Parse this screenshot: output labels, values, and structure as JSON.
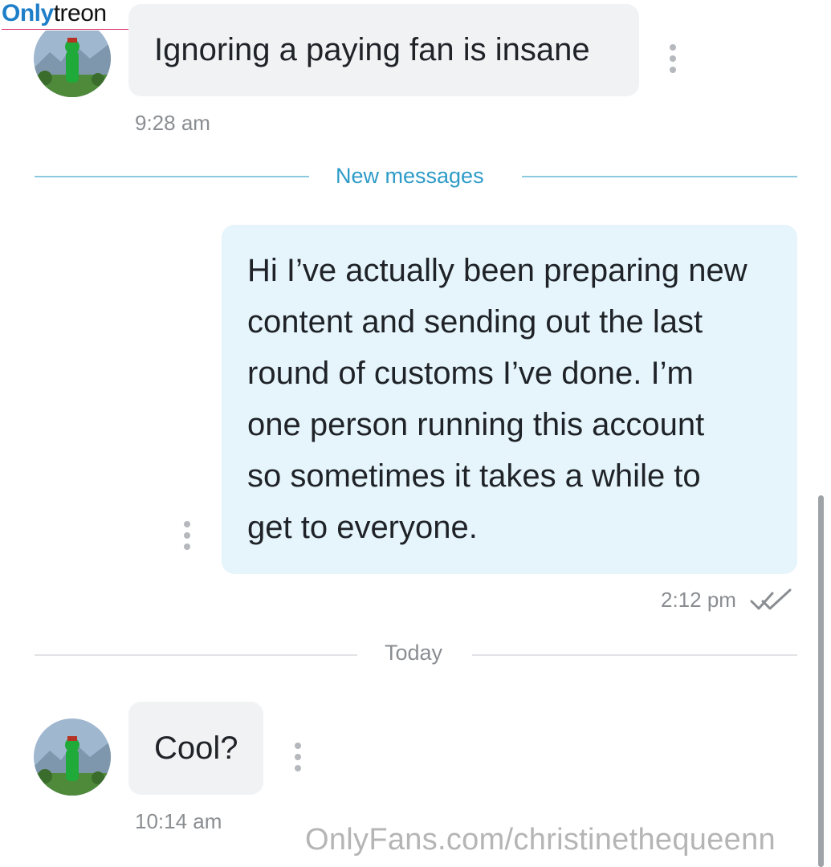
{
  "watermark": {
    "top_bold": "Only",
    "top_thin": "treon",
    "bottom": "OnlyFans.com/christinethequeenn"
  },
  "conversation": {
    "messages": [
      {
        "direction": "incoming",
        "text": "Ignoring a paying fan is insane",
        "time": "9:28 am"
      },
      {
        "direction": "outgoing",
        "lines": [
          "Hi I’ve actually been preparing new",
          "content and sending out the last",
          "round of customs I’ve done. I’m",
          "one person running this account",
          "so sometimes it takes a while to",
          "get to everyone."
        ],
        "time": "2:12 pm",
        "status_icon": "double-check-icon"
      },
      {
        "direction": "incoming",
        "text": "Cool?",
        "time": "10:14 am"
      }
    ],
    "dividers": {
      "new_messages": "New messages",
      "today": "Today"
    }
  },
  "colors": {
    "incoming_bubble": "#f0f2f4",
    "outgoing_bubble": "#e5f5fb",
    "new_messages_accent": "#2d9bc7",
    "timestamp": "#8a8d91",
    "watermark_blue": "#1e7fc8"
  },
  "icons": {
    "avatar": "avatar-icon",
    "menu": "more-vertical-icon",
    "read_receipt": "double-check-icon"
  }
}
